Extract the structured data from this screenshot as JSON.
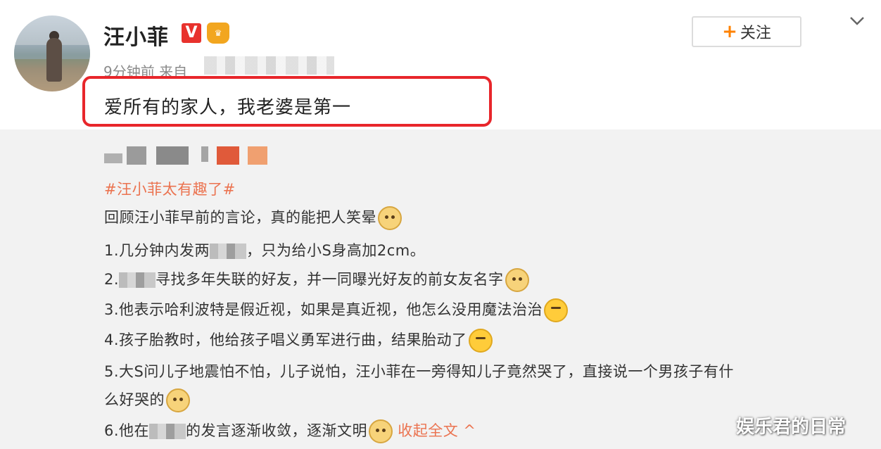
{
  "post": {
    "username": "汪小菲",
    "badge_v": "V",
    "time": "9分钟前",
    "source_prefix": "来自",
    "follow_label": "关注",
    "follow_plus": "+",
    "text": "爱所有的家人，我老婆是第一"
  },
  "repost": {
    "hashtag": "#汪小菲太有趣了#",
    "lines": [
      "回顾汪小菲早前的言论，真的能把人笑晕",
      "1.几分钟内发两",
      "，只为给小S身高加2cm。",
      "2.",
      "寻找多年失联的好友，并一同曝光好友的前女友名字",
      "3.他表示哈利波特是假近视，如果是真近视，他怎么没用魔法治治",
      "4.孩子胎教时，他给孩子唱义勇军进行曲，结果胎动了",
      "5.大S问儿子地震怕不怕，儿子说怕，汪小菲在一旁得知儿子竟然哭了，直接说一个男孩子有什",
      "么好哭的",
      "6.他在",
      "的发言逐渐收敛，逐渐文明",
      "收起全文 ^"
    ]
  },
  "watermark": "娱乐君的日常"
}
